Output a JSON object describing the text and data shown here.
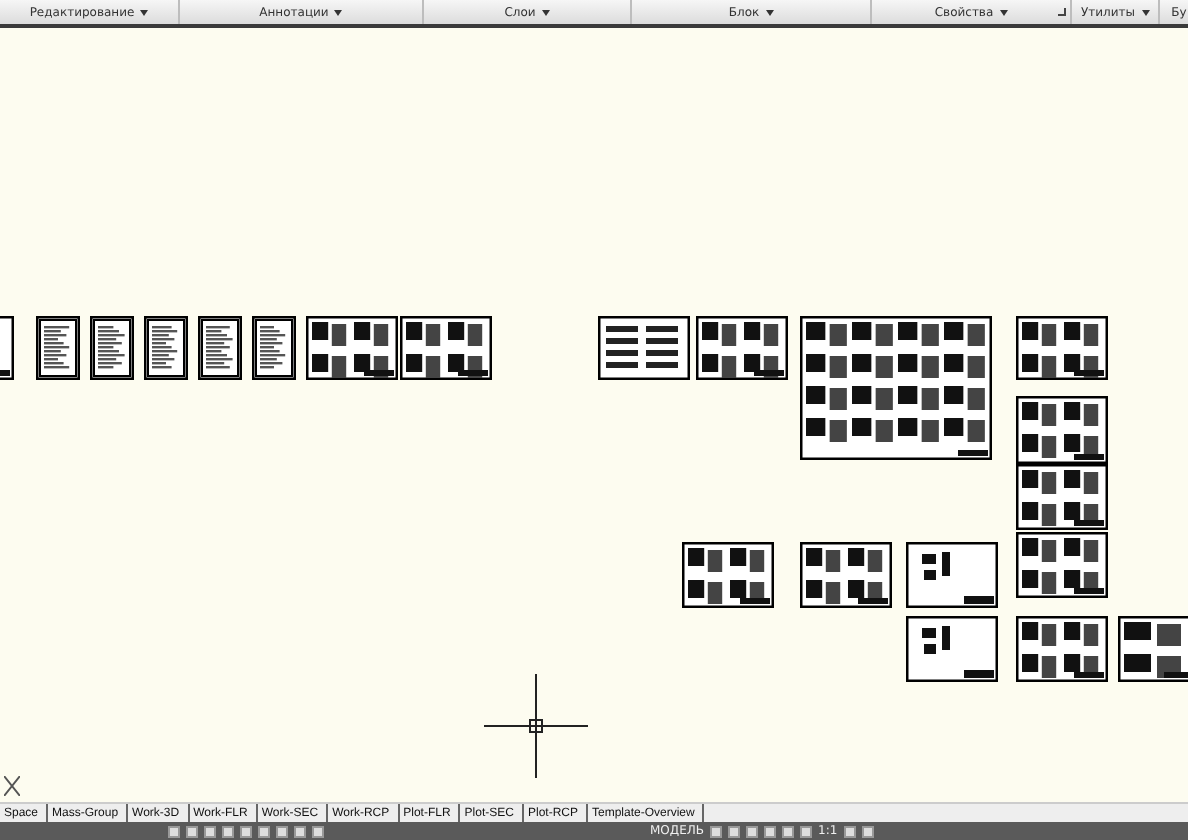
{
  "ribbon_panels": [
    {
      "label": "Редактирование",
      "launcher": false
    },
    {
      "label": "Аннотации",
      "launcher": false
    },
    {
      "label": "Слои",
      "launcher": false
    },
    {
      "label": "Блок",
      "launcher": false
    },
    {
      "label": "Свойства",
      "launcher": true
    },
    {
      "label": "Утилиты",
      "launcher": false
    },
    {
      "label": "Бу",
      "launcher": false
    }
  ],
  "layout_tabs": [
    {
      "label": "Space"
    },
    {
      "label": "Mass-Group"
    },
    {
      "label": "Work-3D"
    },
    {
      "label": "Work-FLR"
    },
    {
      "label": "Work-SEC"
    },
    {
      "label": "Work-RCP"
    },
    {
      "label": "Plot-FLR"
    },
    {
      "label": "Plot-SEC"
    },
    {
      "label": "Plot-RCP"
    },
    {
      "label": "Template-Overview"
    }
  ],
  "status_bar": {
    "space": "МОДЕЛЬ",
    "scale": "1:1"
  }
}
